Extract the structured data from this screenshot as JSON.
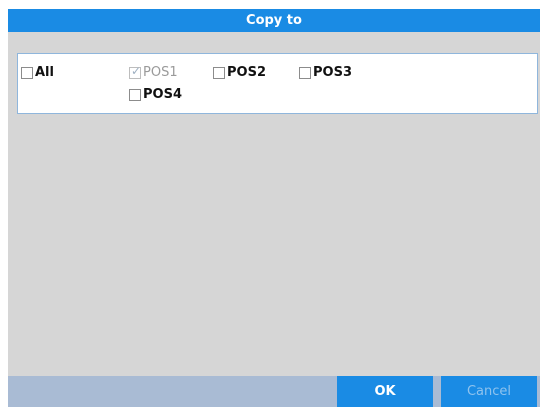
{
  "dialog": {
    "title": "Copy to"
  },
  "options": {
    "all": {
      "label": "All",
      "checked": false,
      "disabled": false
    },
    "pos1": {
      "label": "POS1",
      "checked": true,
      "disabled": true
    },
    "pos2": {
      "label": "POS2",
      "checked": false,
      "disabled": false
    },
    "pos3": {
      "label": "POS3",
      "checked": false,
      "disabled": false
    },
    "pos4": {
      "label": "POS4",
      "checked": false,
      "disabled": false
    }
  },
  "buttons": {
    "ok": "OK",
    "cancel": "Cancel"
  },
  "colors": {
    "accent": "#1a8be4",
    "footer": "#a9bbd4",
    "panel_bg": "#d6d6d6"
  }
}
